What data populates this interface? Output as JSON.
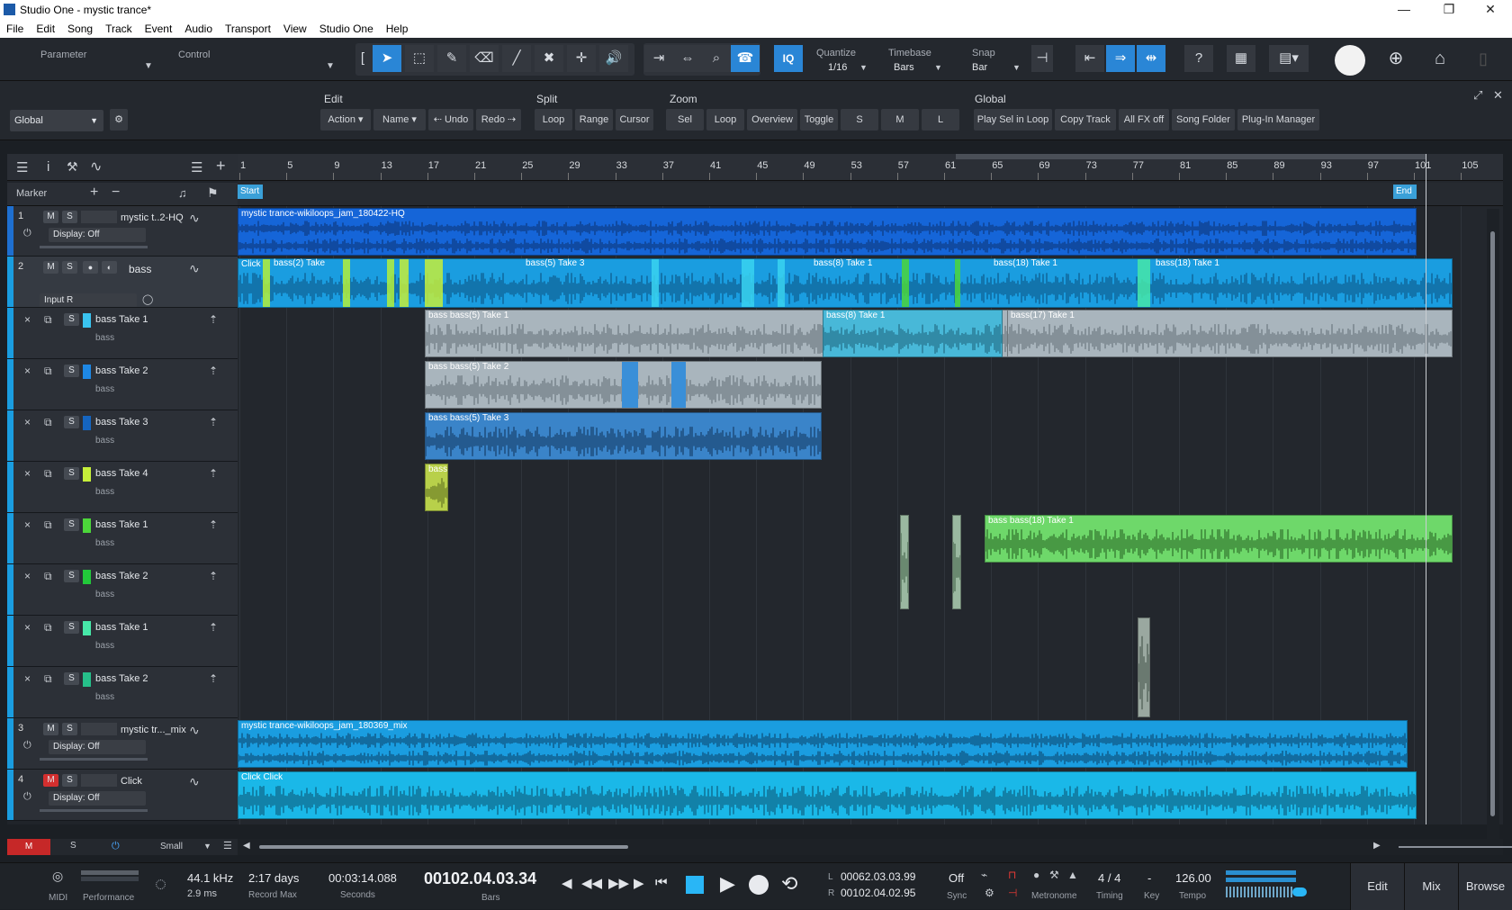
{
  "window": {
    "title": "Studio One - mystic trance*"
  },
  "menu": [
    "File",
    "Edit",
    "Song",
    "Track",
    "Event",
    "Audio",
    "Transport",
    "View",
    "Studio One",
    "Help"
  ],
  "toolbar": {
    "parameter_label": "Parameter",
    "control_label": "Control",
    "quantize": {
      "label": "Quantize",
      "value": "1/16"
    },
    "timebase": {
      "label": "Timebase",
      "value": "Bars"
    },
    "snap": {
      "label": "Snap",
      "value": "Bar"
    },
    "iq_label": "IQ",
    "help_label": "?"
  },
  "subbar": {
    "scope": "Global",
    "edit": {
      "label": "Edit",
      "action": "Action",
      "name": "Name",
      "undo": "Undo",
      "redo": "Redo"
    },
    "split": {
      "label": "Split",
      "loop": "Loop",
      "range": "Range",
      "cursor": "Cursor"
    },
    "zoom": {
      "label": "Zoom",
      "sel": "Sel",
      "loop": "Loop",
      "overview": "Overview",
      "toggle": "Toggle",
      "s": "S",
      "m": "M",
      "l": "L"
    },
    "global": {
      "label": "Global",
      "play_sel_loop": "Play Sel in Loop",
      "copy_track": "Copy Track",
      "all_fx_off": "All FX off",
      "song_folder": "Song Folder",
      "plugin_manager": "Plug-In Manager"
    }
  },
  "ruler": {
    "ticks": [
      "1",
      "5",
      "9",
      "13",
      "17",
      "21",
      "25",
      "29",
      "33",
      "37",
      "41",
      "45",
      "49",
      "53",
      "57",
      "61",
      "65",
      "69",
      "73",
      "77",
      "81",
      "85",
      "89",
      "93",
      "97",
      "101",
      "105"
    ],
    "start": "Start",
    "end": "End"
  },
  "marker_label": "Marker",
  "tracks": [
    {
      "num": "1",
      "m": "M",
      "s": "S",
      "name": "mystic t..2-HQ",
      "display": "Display: Off"
    },
    {
      "num": "2",
      "m": "M",
      "s": "S",
      "name": "bass",
      "input": "Input R"
    },
    {
      "x": "×",
      "s": "S",
      "name": "bass Take 1",
      "sub": "bass",
      "color": "#3ac4f0"
    },
    {
      "x": "×",
      "s": "S",
      "name": "bass Take 2",
      "sub": "bass",
      "color": "#1e88e5"
    },
    {
      "x": "×",
      "s": "S",
      "name": "bass Take 3",
      "sub": "bass",
      "color": "#1565c0"
    },
    {
      "x": "×",
      "s": "S",
      "name": "bass Take 4",
      "sub": "bass",
      "color": "#c6ef3a"
    },
    {
      "x": "×",
      "s": "S",
      "name": "bass Take 1",
      "sub": "bass",
      "color": "#4cd63a"
    },
    {
      "x": "×",
      "s": "S",
      "name": "bass Take 2",
      "sub": "bass",
      "color": "#22c93a"
    },
    {
      "x": "×",
      "s": "S",
      "name": "bass Take 1",
      "sub": "bass",
      "color": "#47e8a8"
    },
    {
      "x": "×",
      "s": "S",
      "name": "bass Take 2",
      "sub": "bass",
      "color": "#26c08a"
    },
    {
      "num": "3",
      "m": "M",
      "s": "S",
      "name": "mystic tr..._mix",
      "display": "Display: Off"
    },
    {
      "num": "4",
      "m": "M",
      "s": "S",
      "name": "Click",
      "display": "Display: Off"
    }
  ],
  "events": {
    "t1": "mystic trance-wikiloops_jam_180422-HQ",
    "t2a": "Click",
    "t2b": "bass(2) Take",
    "t2c": "bass(5) Take 3",
    "t2d": "bass(8) Take 1",
    "t2e": "bass(18) Take 1",
    "t2f": "bass(18) Take 1",
    "tk1a": "bass  bass(5) Take 1",
    "tk1b": "bass(8) Take 1",
    "tk1c": "bass(17) Take 1",
    "tk2": "bass  bass(5) Take 2",
    "tk3": "bass  bass(5) Take 3",
    "tk4": "bass",
    "tk5": "bass  bass(18) Take 1",
    "t3": "mystic trance-wikiloops_jam_180369_mix",
    "t4": "Click  Click"
  },
  "bottom_left": {
    "m": "M",
    "s": "S",
    "size": "Small"
  },
  "transport": {
    "midi": "MIDI",
    "performance": "Performance",
    "sample_rate": "44.1 kHz",
    "latency": "2.9 ms",
    "record_max": "2:17 days",
    "record_max_label": "Record Max",
    "seconds": "00:03:14.088",
    "seconds_label": "Seconds",
    "bars": "00102.04.03.34",
    "bars_label": "Bars",
    "loop_l_label": "L",
    "loop_l": "00062.03.03.99",
    "loop_r_label": "R",
    "loop_r": "00102.04.02.95",
    "sync": "Off",
    "sync_label": "Sync",
    "metronome_label": "Metronome",
    "timing": "4 / 4",
    "timing_label": "Timing",
    "key": "-",
    "key_label": "Key",
    "tempo": "126.00",
    "tempo_label": "Tempo",
    "edit": "Edit",
    "mix": "Mix",
    "browse": "Browse"
  }
}
